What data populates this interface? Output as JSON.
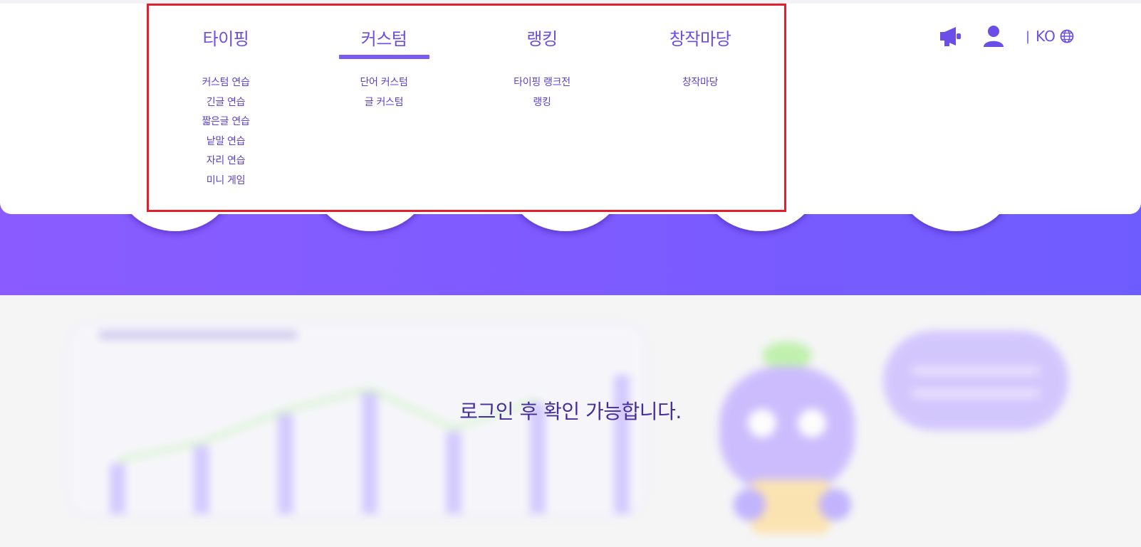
{
  "nav": {
    "columns": [
      {
        "title": "타이핑",
        "active": false,
        "items": [
          "커스텀 연습",
          "긴글 연습",
          "짧은글 연습",
          "낱말 연습",
          "자리 연습",
          "미니 게임"
        ]
      },
      {
        "title": "커스텀",
        "active": true,
        "items": [
          "단어 커스텀",
          "글 커스텀"
        ]
      },
      {
        "title": "랭킹",
        "active": false,
        "items": [
          "타이핑 랭크전",
          "랭킹"
        ]
      },
      {
        "title": "창작마당",
        "active": false,
        "items": [
          "창작마당"
        ]
      }
    ]
  },
  "utils": {
    "announce_icon": "megaphone-icon",
    "user_icon": "user-icon",
    "separator": "|",
    "language": "KO",
    "globe_icon": "globe-icon"
  },
  "content": {
    "login_message": "로그인 후 확인 가능합니다."
  },
  "colors": {
    "accent": "#6b4de8",
    "hero": "#7b5bff",
    "highlight_border": "#e2202c",
    "background": "#f5f5f6"
  }
}
